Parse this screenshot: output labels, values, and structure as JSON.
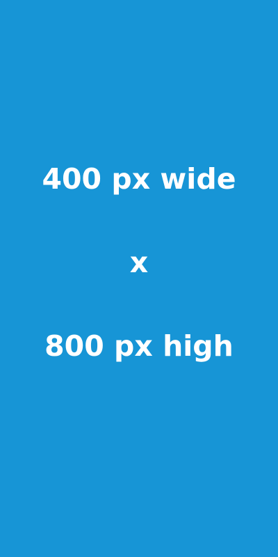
{
  "placeholder": {
    "line_1": "400 px wide",
    "line_2": "x",
    "line_3": "800 px high",
    "background_color": "#1795d6",
    "text_color": "#ffffff"
  }
}
